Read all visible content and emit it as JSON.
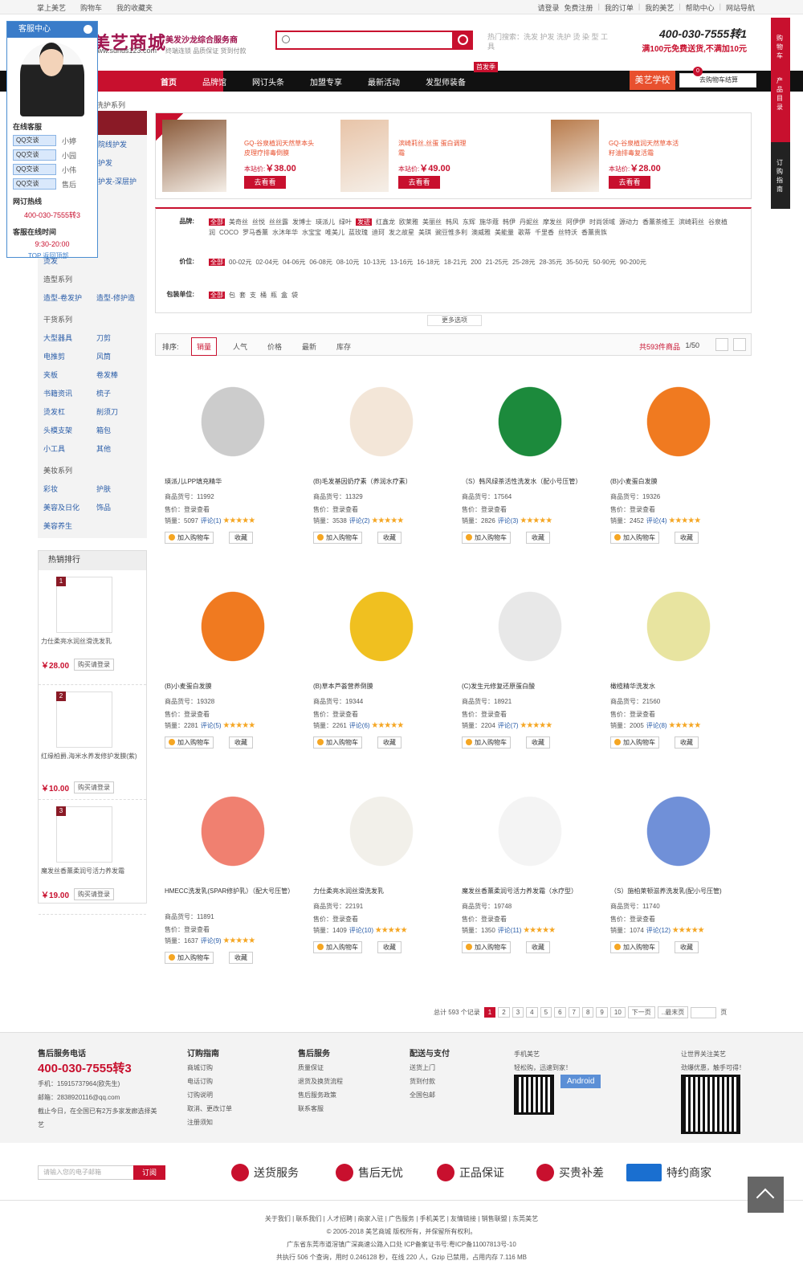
{
  "topbar": {
    "left": [
      "掌上美艺",
      "购物车",
      "我的收藏夹"
    ],
    "right": [
      "请登录",
      "免费注册",
      "我的订单",
      "我的美艺",
      "帮助中心",
      "网站导航"
    ]
  },
  "logo": {
    "name": "美艺商城",
    "url": "www.sunus123.com",
    "slogan": "美发沙龙综合服务商",
    "slogan_sub": "终端连锁 品质保证 货到付款"
  },
  "search": {
    "hot": "热门搜索：洗发 护发 洗护 烫 染 型 工具"
  },
  "phone": {
    "number": "400-030-7555转1",
    "sub": "满100元免费送货,不满加10元"
  },
  "nav": {
    "items": [
      "首页",
      "品牌馆",
      "网订头条",
      "加盟专享",
      "最新活动",
      "发型师装备"
    ],
    "badge": "首发季",
    "school": "美艺学校",
    "cart": "去购物车结算",
    "cart_count": "0"
  },
  "crumb": "洗护系列",
  "cs": {
    "title": "客服中心",
    "online": "在线客服",
    "agents": [
      {
        "btn": "QQ交谈",
        "name": "小婷"
      },
      {
        "btn": "QQ交谈",
        "name": "小园"
      },
      {
        "btn": "QQ交谈",
        "name": "小伟"
      },
      {
        "btn": "QQ交谈",
        "name": "售后"
      }
    ],
    "hotline_label": "网订热线",
    "hotline": "400-030-7555转3",
    "time_label": "客服在线时间",
    "time": "9:30-20:00",
    "top": "TOP 返回顶部"
  },
  "sidebar": {
    "top": [
      [
        "院线护发",
        ""
      ],
      [
        "护发",
        ""
      ],
      [
        "护发-深层护",
        ""
      ]
    ],
    "perm": "烫发",
    "groups": [
      {
        "title": "造型系列",
        "items": [
          "造型-卷发护",
          "造型-修护造"
        ]
      },
      {
        "title": "干货系列",
        "items": [
          "大型器具",
          "刀剪",
          "电推剪",
          "风筒",
          "夹板",
          "卷发棒",
          "书籍资讯",
          "梳子",
          "烫发杠",
          "削须刀",
          "头模支架",
          "箱包",
          "小工具",
          "其他"
        ]
      },
      {
        "title": "美妆系列",
        "items": [
          "彩妆",
          "护肤",
          "美容及日化",
          "饰品",
          "美容养生"
        ]
      }
    ]
  },
  "hot_rank": {
    "title": "热销排行",
    "items": [
      {
        "no": "1",
        "name": "力仕柔亮水润丝滑洗发乳",
        "price": "￥28.00",
        "buy": "购买请登录"
      },
      {
        "no": "2",
        "name": "红缘柏爵,海米水养发修护发膜(紫)",
        "price": "￥10.00",
        "buy": "购买请登录"
      },
      {
        "no": "3",
        "name": "魔发丝香薰柔润号活力养发霜",
        "price": "￥19.00",
        "buy": "购买请登录"
      }
    ]
  },
  "promo": [
    {
      "name": "GQ-谷泉植润天然草本头皮理疗排毒倒膜",
      "price": "￥38.00",
      "label": "本站价:",
      "go": "去看看"
    },
    {
      "name": "滨崎莉丝,丝蛋 蛋白调理霜",
      "price": "￥49.00",
      "label": "本站价:",
      "go": "去看看"
    },
    {
      "name": "GQ-谷泉植润天然草本活籽油排毒复活霜",
      "price": "￥28.00",
      "label": "本站价:",
      "go": "去看看"
    }
  ],
  "filter": {
    "brand_label": "品牌:",
    "brands": "全部 美奇丝 丝悦 丝丝露 发博士 瑛派儿 绿叶 发迹 红鑫龙 欧莱雅 美丽丝 韩风 东辉 施华蔻 韩伊 丹妮丝 摩发丝 阿伊伊 时尚领域 源动力 香薰茶维王 滨崎莉丝 谷泉植润 COCO 罗马香薰 水沐年华 水宝宝 唯美儿 蓝玫瑰 迪珂 发之故星 美琪 豌豆惟多利 澳威雅 美能量 歌蒂 千里香 丝特沃 香薰贵族",
    "price_label": "价位:",
    "prices": "全部 00-02元 02-04元 04-06元 06-08元 08-10元 10-13元 13-16元 16-18元 18-21元 200 21-25元 25-28元 28-35元 35-50元 50-90元 90-200元",
    "unit_label": "包装单位:",
    "units": "全部 包 套 支 桶 瓶 盒 袋",
    "more": "更多选项"
  },
  "sort": {
    "label": "排序:",
    "items": [
      "销量",
      "人气",
      "价格",
      "最新",
      "库存"
    ],
    "count": "共593件商品",
    "page": "1/50"
  },
  "products": [
    {
      "name": "瑛派儿LPP填充精华",
      "code": "11992",
      "price": "登录查看",
      "sales": "5097",
      "reviews": "评论(1)"
    },
    {
      "name": "(B)毛发基因奶疗素（养润水疗素）",
      "code": "11329",
      "price": "登录查看",
      "sales": "3538",
      "reviews": "评论(2)"
    },
    {
      "name": "（S）韩风绿茶活性洗发水（配小号压管）",
      "code": "17564",
      "price": "登录查看",
      "sales": "2826",
      "reviews": "评论(3)"
    },
    {
      "name": "(B)小麦蛋白发膜",
      "code": "19326",
      "price": "登录查看",
      "sales": "2452",
      "reviews": "评论(4)"
    },
    {
      "name": "(B)小麦蛋白发膜",
      "code": "19328",
      "price": "登录查看",
      "sales": "2281",
      "reviews": "评论(5)"
    },
    {
      "name": "(B)草本芦荟营养倒膜",
      "code": "19344",
      "price": "登录查看",
      "sales": "2261",
      "reviews": "评论(6)"
    },
    {
      "name": "(C)发生元修复还原蛋白酸",
      "code": "18921",
      "price": "登录查看",
      "sales": "2204",
      "reviews": "评论(7)"
    },
    {
      "name": "橄榄精华洗发水",
      "code": "21560",
      "price": "登录查看",
      "sales": "2005",
      "reviews": "评论(8)"
    },
    {
      "name": "HMECC洗发乳(SPAR修护乳）（配大号压管）",
      "code": "11891",
      "price": "登录查看",
      "sales": "1637",
      "reviews": "评论(9)"
    },
    {
      "name": "力仕柔亮水润丝滑洗发乳",
      "code": "22191",
      "price": "登录查看",
      "sales": "1409",
      "reviews": "评论(10)"
    },
    {
      "name": "魔发丝香薰柔润号活力养发霜（水疗型）",
      "code": "19748",
      "price": "登录查看",
      "sales": "1350",
      "reviews": "评论(11)"
    },
    {
      "name": "（S）施柏莱顿滋养洗发乳(配小号压管)",
      "code": "11740",
      "price": "登录查看",
      "sales": "1074",
      "reviews": "评论(12)"
    }
  ],
  "product_labels": {
    "code": "商品货号：",
    "price": "售价：",
    "sales": "销量：",
    "add": "加入购物车",
    "fav": "收藏"
  },
  "pager": {
    "total": "总计 593 个记录",
    "pages": [
      "1",
      "2",
      "3",
      "4",
      "5",
      "6",
      "7",
      "8",
      "9",
      "10"
    ],
    "next": "下一页",
    "last": "..最末页",
    "page": "页"
  },
  "footer": {
    "svc_title": "售后服务电话",
    "svc_phone": "400-030-7555转3",
    "mobile": "手机：15915737964(欧先生)",
    "email": "邮箱：2838920116@qq.com",
    "note": "截止今日，在全国已有2万多家发廊选择美艺",
    "cols": [
      {
        "title": "订购指南",
        "items": [
          "商城订购",
          "电话订购",
          "订购说明",
          "取消、更改订单",
          "注册须知"
        ]
      },
      {
        "title": "售后服务",
        "items": [
          "质量保证",
          "退货及换货流程",
          "售后服务政策",
          "联系客服"
        ]
      },
      {
        "title": "配送与支付",
        "items": [
          "送货上门",
          "货到付款",
          "全国包邮"
        ]
      }
    ],
    "app_title": "手机美艺",
    "app_sub": "轻松购，迅速到家！",
    "android": "Android",
    "wx_title": "让世界关注美艺",
    "wx_sub": "劲爆优惠，触手可得！"
  },
  "service": {
    "placeholder": "请输入您的电子邮箱",
    "subscribe": "订阅",
    "items": [
      "送货服务",
      "售后无忧",
      "正品保证",
      "买贵补差",
      "特约商家"
    ]
  },
  "links": {
    "row": "关于我们 | 联系我们 | 人才招聘 | 商家入驻 | 广告服务 | 手机美艺 | 友情链接 | 销售联盟 | 东莞美艺",
    "copy": "© 2005-2018 美艺商城 版权所有，并保留所有权利。",
    "addr": "广东省东莞市道滘镇广深高速公路入口处 ICP备案证书号:粤ICP备11007813号-10",
    "stat": "共执行 506 个查询，用时 0.246128 秒，在线 220 人，Gzip 已禁用，占用内存 7.116 MB"
  },
  "rbar": {
    "cart": "购物车",
    "dir": "产品目录",
    "guide": "订购指南"
  }
}
